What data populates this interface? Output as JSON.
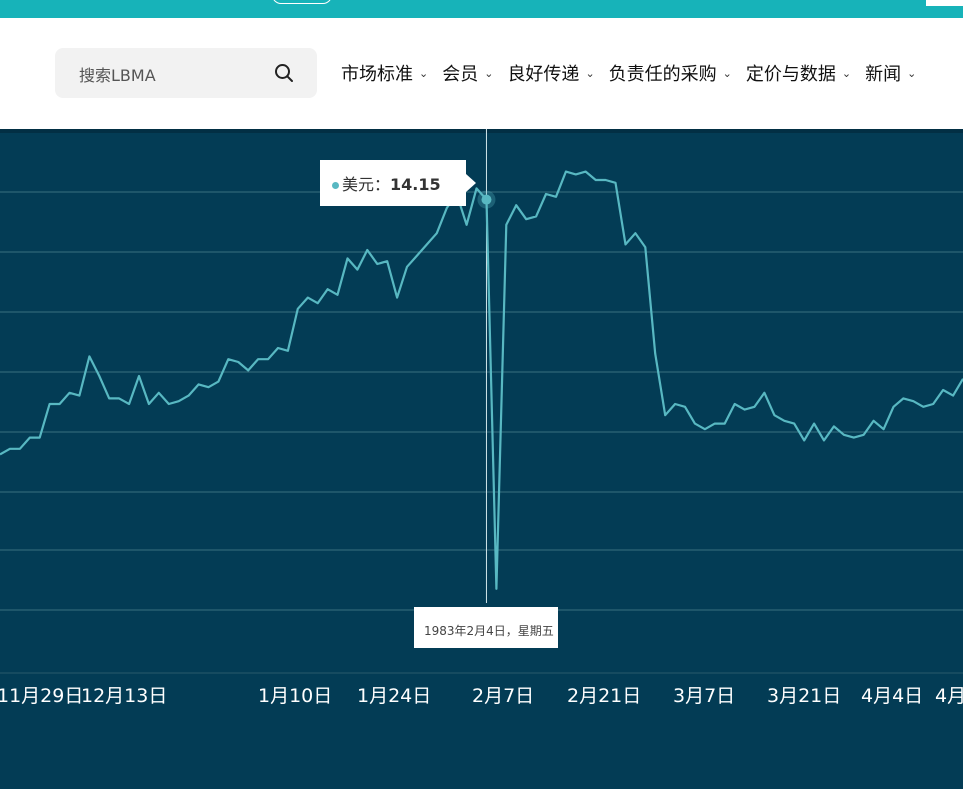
{
  "search": {
    "placeholder": "搜索LBMA"
  },
  "nav": {
    "items": [
      {
        "label": "市场标准",
        "name": "nav-item-market-standards"
      },
      {
        "label": "会员",
        "name": "nav-item-members"
      },
      {
        "label": "良好传递",
        "name": "nav-item-good-delivery"
      },
      {
        "label": "负责任的采购",
        "name": "nav-item-responsible-sourcing"
      },
      {
        "label": "定价与数据",
        "name": "nav-item-prices-data"
      },
      {
        "label": "新闻",
        "name": "nav-item-news"
      }
    ]
  },
  "tooltip": {
    "series_label": "美元：",
    "value": "14.15",
    "date_label": "1983年2月4日，星期五"
  },
  "colors": {
    "brand": "#17b3b9",
    "chart_bg": "#033c55",
    "line": "#58b8c2",
    "grid": "#3a6f80"
  },
  "chart_data": {
    "type": "line",
    "xlabel": "",
    "ylabel": "",
    "x_tick_labels": [
      "11月29日",
      "12月13日",
      "1月10日",
      "1月24日",
      "2月7日",
      "2月21日",
      "3月7日",
      "3月21日",
      "4月4日",
      "4月"
    ],
    "series": [
      {
        "name": "美元",
        "values": [
          9.6,
          9.7,
          9.7,
          9.9,
          9.9,
          10.5,
          10.5,
          10.7,
          10.65,
          11.35,
          11.0,
          10.6,
          10.6,
          10.5,
          11.0,
          10.5,
          10.7,
          10.5,
          10.55,
          10.65,
          10.85,
          10.8,
          10.9,
          11.3,
          11.25,
          11.1,
          11.3,
          11.3,
          11.5,
          11.45,
          12.2,
          12.4,
          12.3,
          12.55,
          12.45,
          13.1,
          12.9,
          13.25,
          13.0,
          13.05,
          12.4,
          12.95,
          13.15,
          13.35,
          13.55,
          14.0,
          14.25,
          13.7,
          14.35,
          14.15,
          7.2,
          13.7,
          14.05,
          13.8,
          13.85,
          14.25,
          14.2,
          14.65,
          14.6,
          14.65,
          14.5,
          14.5,
          14.45,
          13.35,
          13.55,
          13.3,
          11.4,
          10.3,
          10.5,
          10.45,
          10.15,
          10.05,
          10.15,
          10.15,
          10.5,
          10.4,
          10.45,
          10.7,
          10.3,
          10.2,
          10.15,
          9.85,
          10.15,
          9.85,
          10.1,
          9.95,
          9.9,
          9.95,
          10.2,
          10.05,
          10.45,
          10.6,
          10.55,
          10.45,
          10.5,
          10.75,
          10.65,
          10.95
        ]
      }
    ],
    "highlight": {
      "series": "美元",
      "value": 14.15,
      "date": "1983年2月4日，星期五"
    },
    "grid": true
  }
}
